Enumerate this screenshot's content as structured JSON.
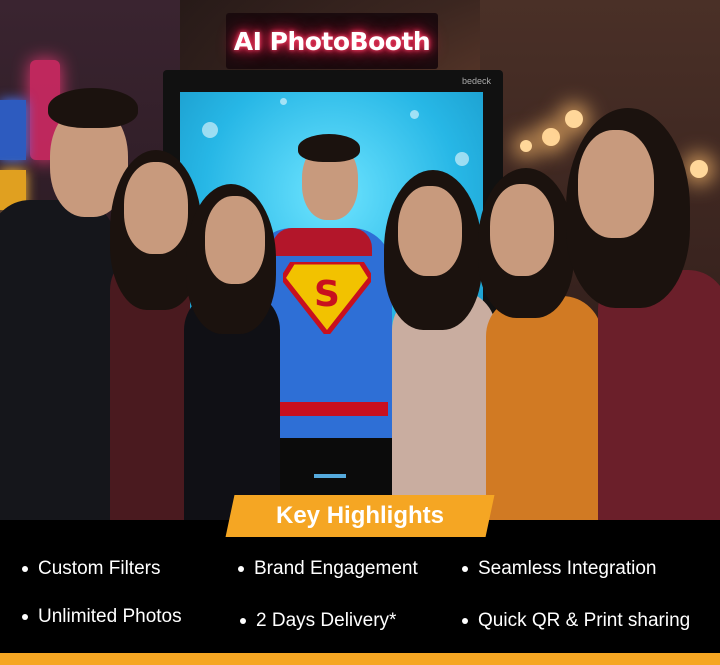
{
  "sign": {
    "text": "AI PhotoBooth"
  },
  "booth": {
    "brand": "bedeck"
  },
  "badge": {
    "label": "Key Highlights"
  },
  "highlights": [
    {
      "label": "Custom Filters"
    },
    {
      "label": "Brand Engagement"
    },
    {
      "label": "Seamless Integration"
    },
    {
      "label": "Unlimited Photos"
    },
    {
      "label": "2 Days Delivery*"
    },
    {
      "label": "Quick QR & Print sharing"
    }
  ],
  "colors": {
    "accent": "#f5a623",
    "panel": "#000000",
    "neon": "#ff2050",
    "screen": "#27b7e6"
  },
  "icons": [
    "bullet-dot-icon",
    "superman-shield-icon"
  ]
}
